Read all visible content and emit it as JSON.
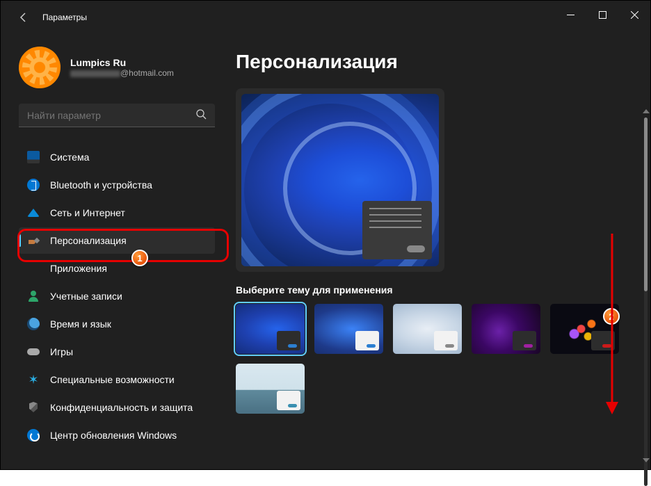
{
  "window": {
    "title": "Параметры"
  },
  "user": {
    "name": "Lumpics Ru",
    "email_suffix": "@hotmail.com"
  },
  "search": {
    "placeholder": "Найти параметр"
  },
  "nav": {
    "items": [
      {
        "label": "Система"
      },
      {
        "label": "Bluetooth и устройства"
      },
      {
        "label": "Сеть и Интернет"
      },
      {
        "label": "Персонализация"
      },
      {
        "label": "Приложения"
      },
      {
        "label": "Учетные записи"
      },
      {
        "label": "Время и язык"
      },
      {
        "label": "Игры"
      },
      {
        "label": "Специальные возможности"
      },
      {
        "label": "Конфиденциальность и защита"
      },
      {
        "label": "Центр обновления Windows"
      }
    ]
  },
  "main": {
    "heading": "Персонализация",
    "theme_section_label": "Выберите тему для применения"
  },
  "annotations": {
    "b1": "1",
    "b2": "2"
  }
}
